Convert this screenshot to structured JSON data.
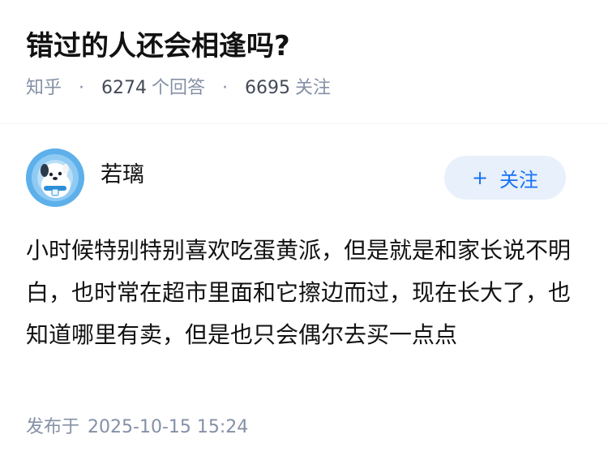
{
  "question": {
    "title": "错过的人还会相逢吗?",
    "source": "知乎",
    "separator": "·",
    "answer_count": "6274",
    "answer_label": "个回答",
    "follower_count": "6695",
    "follower_label": "关注"
  },
  "author": {
    "name": "若璃",
    "avatar_icon": "cartoon-dog-avatar-icon",
    "follow_label": "关注",
    "follow_icon": "plus-icon",
    "follow_color": "#1772f6"
  },
  "answer": {
    "content": "小时候特别特别喜欢吃蛋黄派，但是就是和家长说不明白，也时常在超市里面和它擦边而过，现在长大了，也知道哪里有卖，但是也只会偶尔去买一点点",
    "published_label": "发布于",
    "published_time": "2025-10-15 15:24"
  }
}
